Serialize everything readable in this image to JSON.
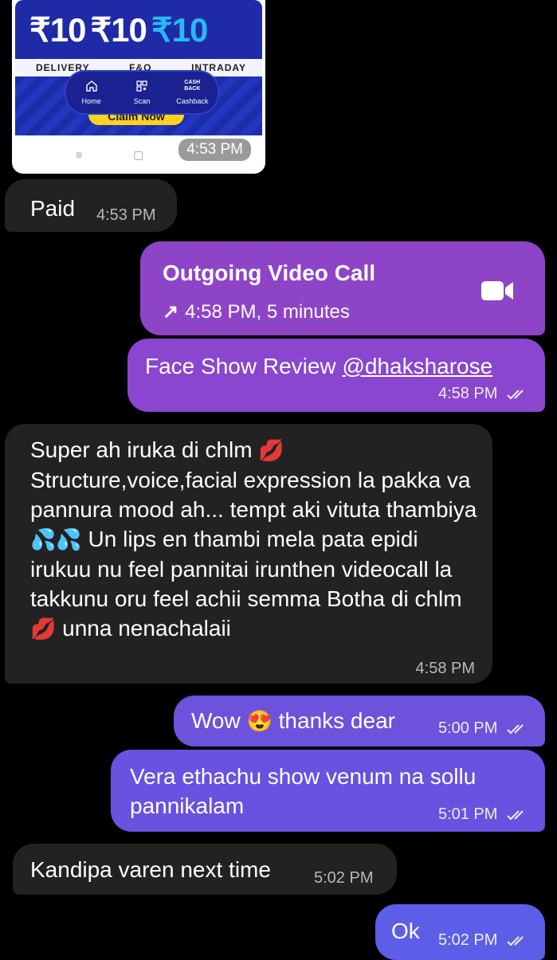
{
  "forwarded_image": {
    "amounts": [
      "₹10",
      "₹10",
      "₹10"
    ],
    "tags": [
      "DELIVERY",
      "F&O",
      "INTRADAY"
    ],
    "nav": [
      {
        "label": "Home",
        "icon": "home-icon"
      },
      {
        "label": "Scan",
        "icon": "qr-scan-icon"
      },
      {
        "label": "Cashback",
        "icon": "cashback-icon",
        "icon_text": "CASH BACK"
      }
    ],
    "claim_label": "Claim Now",
    "system_buttons": [
      "≡",
      "▢"
    ],
    "time": "4:53 PM"
  },
  "messages": {
    "paid": {
      "text": "Paid",
      "time": "4:53 PM",
      "direction": "incoming"
    },
    "video_call": {
      "title": "Outgoing Video Call",
      "arrow": "↗",
      "details": "4:58 PM, 5 minutes",
      "icon": "video-camera-icon",
      "direction": "outgoing"
    },
    "review": {
      "text": "Face Show Review ",
      "mention": "@dhaksharose",
      "time": "4:58 PM",
      "status_icon": "double-check-icon",
      "direction": "outgoing"
    },
    "super": {
      "text_1": "Super ah iruka di chlm ",
      "emoji_1": "💋",
      "text_2": " Structure,voice,facial expression la pakka va pannura mood ah... tempt aki vituta thambiya ",
      "emoji_2": "💦💦",
      "text_3": " Un lips en thambi mela pata epidi irukuu nu feel pannitai irunthen videocall la takkunu oru feel achii semma Botha di chlm ",
      "emoji_3": "💋",
      "text_4": " unna nenachalaii",
      "time": "4:58 PM",
      "direction": "incoming"
    },
    "wow": {
      "text_1": "Wow ",
      "emoji": "😍",
      "text_2": " thanks dear",
      "time": "5:00 PM",
      "status_icon": "double-check-icon",
      "direction": "outgoing"
    },
    "vera": {
      "text": "Vera ethachu show venum na sollu pannikalam",
      "time": "5:01 PM",
      "status_icon": "double-check-icon",
      "direction": "outgoing"
    },
    "kandipa": {
      "text": "Kandipa varen next time",
      "time": "5:02 PM",
      "direction": "incoming"
    },
    "ok": {
      "text": "Ok",
      "time": "5:02 PM",
      "status_icon": "double-check-icon",
      "direction": "outgoing"
    }
  },
  "colors": {
    "background": "#000000",
    "incoming_bubble": "#222222",
    "video_call_bubble": "#8e44c7",
    "review_bubble": "#8a46cf",
    "wow_bubble": "#6d52db",
    "vera_bubble": "#6852e0",
    "ok_bubble": "#5d5ee8"
  }
}
